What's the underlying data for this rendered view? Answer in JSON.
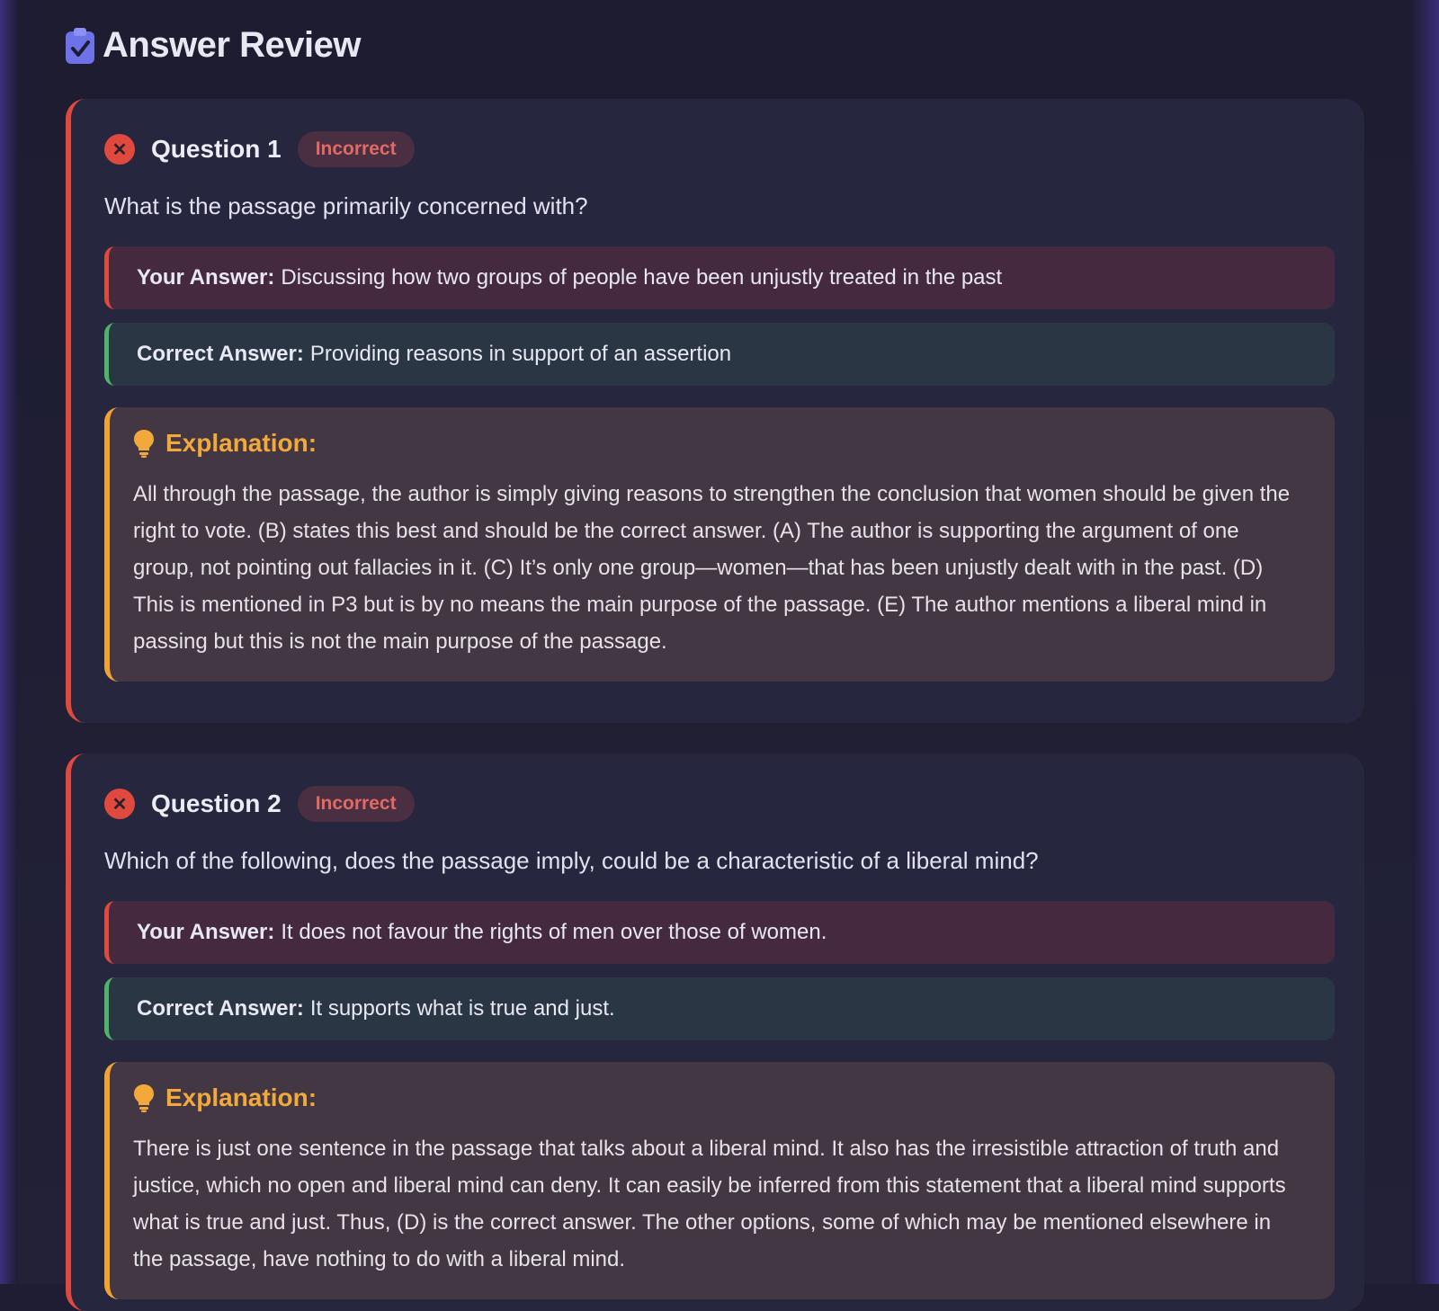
{
  "header": {
    "title": "Answer Review",
    "icon": "clipboard-check-icon"
  },
  "questions": [
    {
      "title": "Question 1",
      "status": "Incorrect",
      "text": "What is the passage primarily concerned with?",
      "your_answer_label": "Your Answer:",
      "your_answer": "Discussing how two groups of people have been unjustly treated in the past",
      "correct_answer_label": "Correct Answer:",
      "correct_answer": "Providing reasons in support of an assertion",
      "explanation_label": "Explanation:",
      "explanation": "All through the passage, the author is simply giving reasons to strengthen the conclusion that women should be given the right to vote. (B) states this best and should be the correct answer. (A) The author is supporting the argument of one group, not pointing out fallacies in it. (C) It’s only one group—women—that has been unjustly dealt with in the past. (D) This is mentioned in P3 but is by no means the main purpose of the passage. (E) The author mentions a liberal mind in passing but this is not the main purpose of the passage."
    },
    {
      "title": "Question 2",
      "status": "Incorrect",
      "text": "Which of the following, does the passage imply, could be a characteristic of a liberal mind?",
      "your_answer_label": "Your Answer:",
      "your_answer": "It does not favour the rights of men over those of women.",
      "correct_answer_label": "Correct Answer:",
      "correct_answer": "It supports what is true and just.",
      "explanation_label": "Explanation:",
      "explanation": "There is just one sentence in the passage that talks about a liberal mind. It also has the irresistible attraction of truth and justice, which no open and liberal mind can deny. It can easily be inferred from this statement that a liberal mind supports what is true and just. Thus, (D) is the correct answer. The other options, some of which may be mentioned elsewhere in the passage, have nothing to do with a liberal mind."
    }
  ],
  "icons": {
    "status": "close-icon",
    "explanation": "lightbulb-icon"
  },
  "colors": {
    "background": "#1c1b2e",
    "card": "#26263f",
    "incorrect": "#e0493e",
    "correct": "#4fb36a",
    "explanation_accent": "#f0a234",
    "header_icon": "#6d72e8"
  }
}
